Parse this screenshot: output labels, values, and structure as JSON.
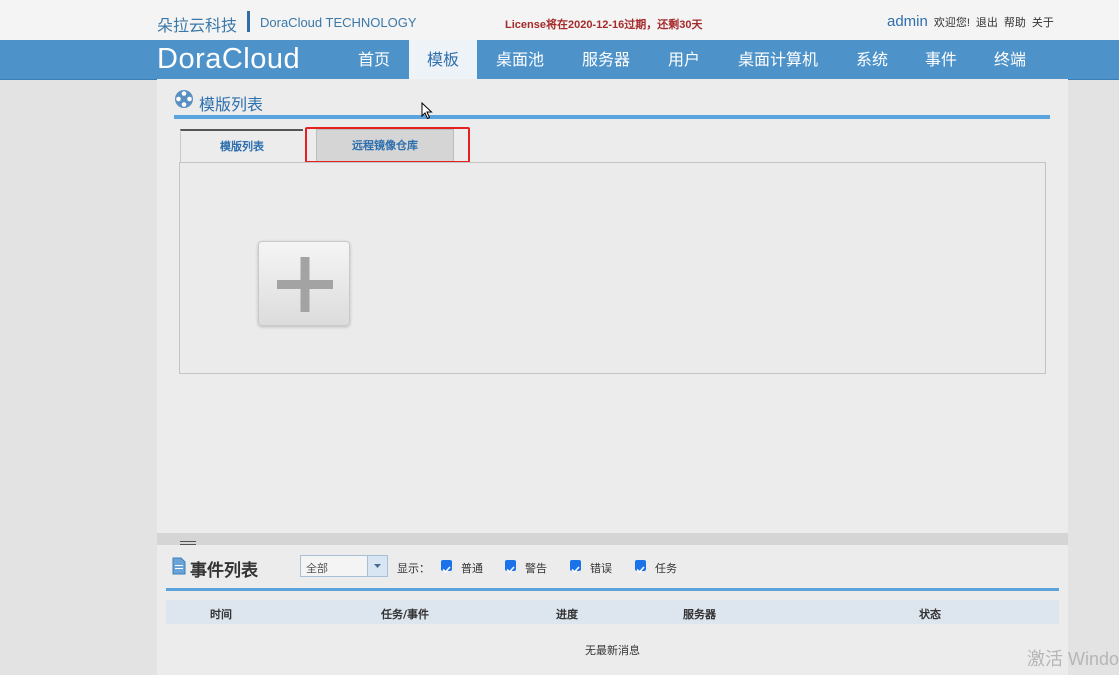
{
  "header": {
    "brand_cn": "朵拉云科技",
    "brand_en": "DoraCloud TECHNOLOGY",
    "license_notice": "License将在2020-12-16过期，还剩30天",
    "user": "admin",
    "welcome": "欢迎您!",
    "links": [
      "退出",
      "帮助",
      "关于"
    ]
  },
  "nav": {
    "logo": "DoraCloud",
    "items": [
      "首页",
      "模板",
      "桌面池",
      "服务器",
      "用户",
      "桌面计算机",
      "系统",
      "事件",
      "终端"
    ],
    "active_index": 1
  },
  "page": {
    "title": "模版列表",
    "tabs": [
      "模版列表",
      "远程镜像仓库"
    ],
    "active_tab": 0,
    "highlighted_tab": 1
  },
  "events": {
    "title": "事件列表",
    "filter_value": "全部",
    "show_label": "显示：",
    "checkboxes": [
      {
        "label": "普通",
        "checked": true
      },
      {
        "label": "警告",
        "checked": true
      },
      {
        "label": "错误",
        "checked": true
      },
      {
        "label": "任务",
        "checked": true
      }
    ],
    "columns": [
      "时间",
      "任务/事件",
      "进度",
      "服务器",
      "状态"
    ],
    "empty_message": "无最新消息"
  },
  "watermark": "激活 Windo",
  "colors": {
    "nav_bg": "#4d92c8",
    "accent": "#2e6fad",
    "license": "#a52a2a",
    "highlight": "#e52020"
  }
}
